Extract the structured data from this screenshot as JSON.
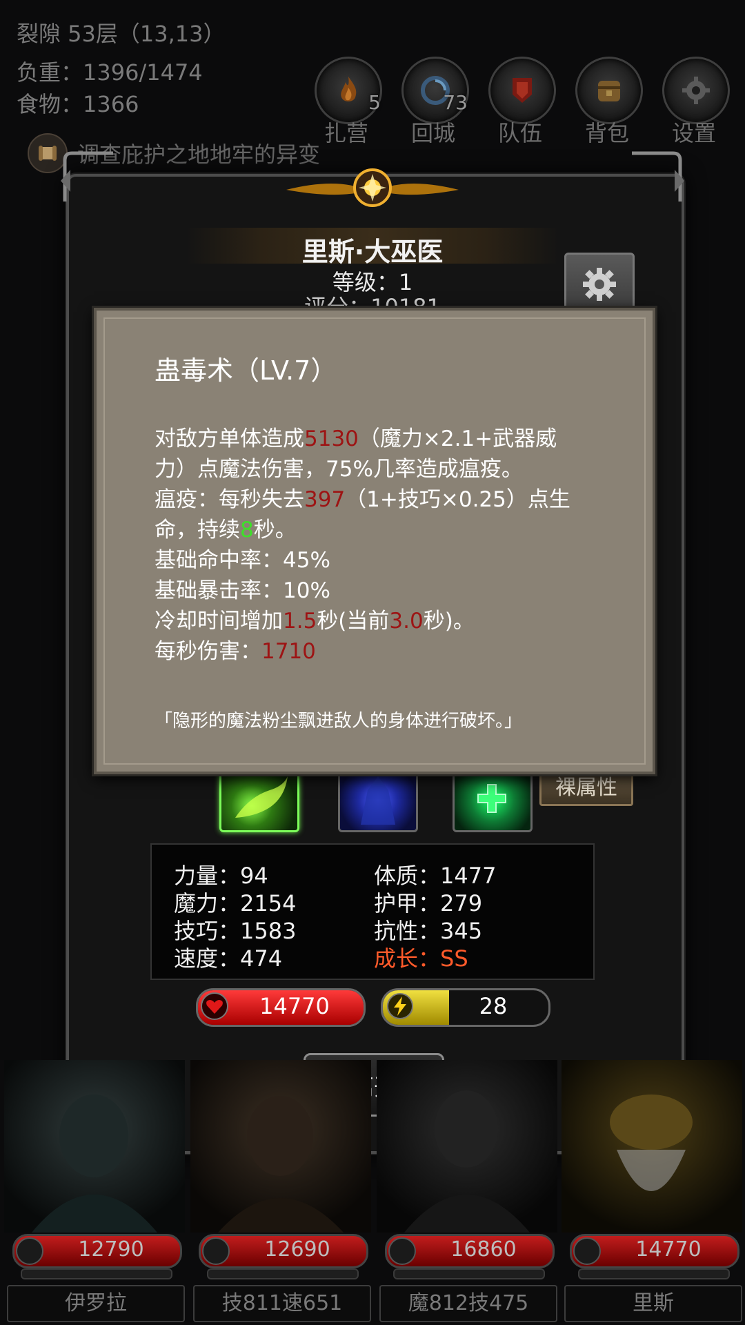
{
  "hud": {
    "location": "裂隙 53层（13,13）",
    "load": "负重：1396/1474",
    "food": "食物：1366",
    "quest": "调查庇护之地地牢的异变"
  },
  "menu": [
    {
      "label": "扎营",
      "badge": "5",
      "icon": "campfire-icon"
    },
    {
      "label": "回城",
      "badge": "73",
      "icon": "portal-icon"
    },
    {
      "label": "队伍",
      "badge": "",
      "icon": "party-icon"
    },
    {
      "label": "背包",
      "badge": "",
      "icon": "backpack-icon"
    },
    {
      "label": "设置",
      "badge": "",
      "icon": "gear-icon"
    }
  ],
  "hero": {
    "name": "里斯·大巫医",
    "level": "等级：1",
    "score": "评分：10181"
  },
  "attr_button": "裸属性",
  "stats": {
    "str": "力量：94",
    "mag": "魔力：2154",
    "skl": "技巧：1583",
    "spd": "速度：474",
    "con": "体质：1477",
    "arm": "护甲：279",
    "res": "抗性：345",
    "growth": "成长：SS"
  },
  "bars": {
    "hp": "14770",
    "hp_fraction": 1.0,
    "mp": "28",
    "mp_fraction": 0.4
  },
  "leave_label": "离开",
  "tooltip": {
    "title": "蛊毒术（LV.7）",
    "l1a": "对敌方单体造成",
    "l1v": "5130",
    "l1b": "（魔力×2.1+武器威",
    "l2": "力）点魔法伤害，75%几率造成瘟疫。",
    "l3a": "瘟疫：每秒失去",
    "l3v": "397",
    "l3b": "（1+技巧×0.25）点生",
    "l4a": "命，持续",
    "l4v": "8",
    "l4b": "秒。",
    "l5": "基础命中率：45%",
    "l6": "基础暴击率：10%",
    "l7a": "冷却时间增加",
    "l7v": "1.5",
    "l7b": "秒(当前",
    "l7c": "3.0",
    "l7d": "秒)。",
    "l8a": "每秒伤害：",
    "l8v": "1710",
    "quote": "「隐形的魔法粉尘飘进敌人的身体进行破坏。」"
  },
  "party": [
    {
      "hp": "12790",
      "name": "伊罗拉"
    },
    {
      "hp": "12690",
      "name": "技811速651"
    },
    {
      "hp": "16860",
      "name": "魔812技475"
    },
    {
      "hp": "14770",
      "name": "里斯"
    }
  ],
  "colors": {
    "accent_red": "#9d1414",
    "accent_green": "#3ee02a",
    "growth_orange": "#ff5a2a",
    "tooltip_bg": "#8a8275"
  }
}
